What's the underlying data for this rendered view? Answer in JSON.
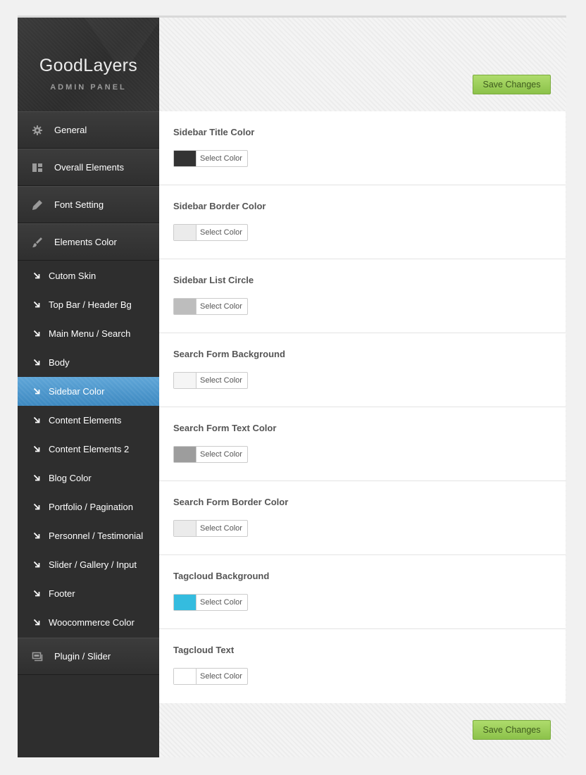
{
  "logo": {
    "title": "GoodLayers",
    "subtitle": "ADMIN PANEL"
  },
  "menu": {
    "items": [
      {
        "label": "General",
        "icon": "gear-icon"
      },
      {
        "label": "Overall Elements",
        "icon": "layout-icon"
      },
      {
        "label": "Font Setting",
        "icon": "pencil-icon"
      },
      {
        "label": "Elements Color",
        "icon": "brush-icon"
      }
    ],
    "submenu": [
      {
        "label": "Cutom Skin"
      },
      {
        "label": "Top Bar / Header Bg"
      },
      {
        "label": "Main Menu / Search"
      },
      {
        "label": "Body"
      },
      {
        "label": "Sidebar Color",
        "active": true
      },
      {
        "label": "Content Elements"
      },
      {
        "label": "Content Elements 2"
      },
      {
        "label": "Blog Color"
      },
      {
        "label": "Portfolio / Pagination"
      },
      {
        "label": "Personnel / Testimonial"
      },
      {
        "label": "Slider / Gallery / Input"
      },
      {
        "label": "Footer"
      },
      {
        "label": "Woocommerce Color"
      }
    ],
    "bottom_item": {
      "label": "Plugin / Slider",
      "icon": "slideshow-icon"
    }
  },
  "toolbar": {
    "save_label": "Save Changes"
  },
  "picker_label": "Select Color",
  "fields": [
    {
      "label": "Sidebar Title Color",
      "color": "#333333"
    },
    {
      "label": "Sidebar Border Color",
      "color": "#ebebeb"
    },
    {
      "label": "Sidebar List Circle",
      "color": "#bdbdbd"
    },
    {
      "label": "Search Form Background",
      "color": "#f5f5f5"
    },
    {
      "label": "Search Form Text Color",
      "color": "#9d9d9d"
    },
    {
      "label": "Search Form Border Color",
      "color": "#ebebeb"
    },
    {
      "label": "Tagcloud Background",
      "color": "#34bcdf"
    },
    {
      "label": "Tagcloud Text",
      "color": "#ffffff"
    }
  ],
  "colors": {
    "accent": "#4a96cc",
    "save_button": "#9ccf5a"
  }
}
